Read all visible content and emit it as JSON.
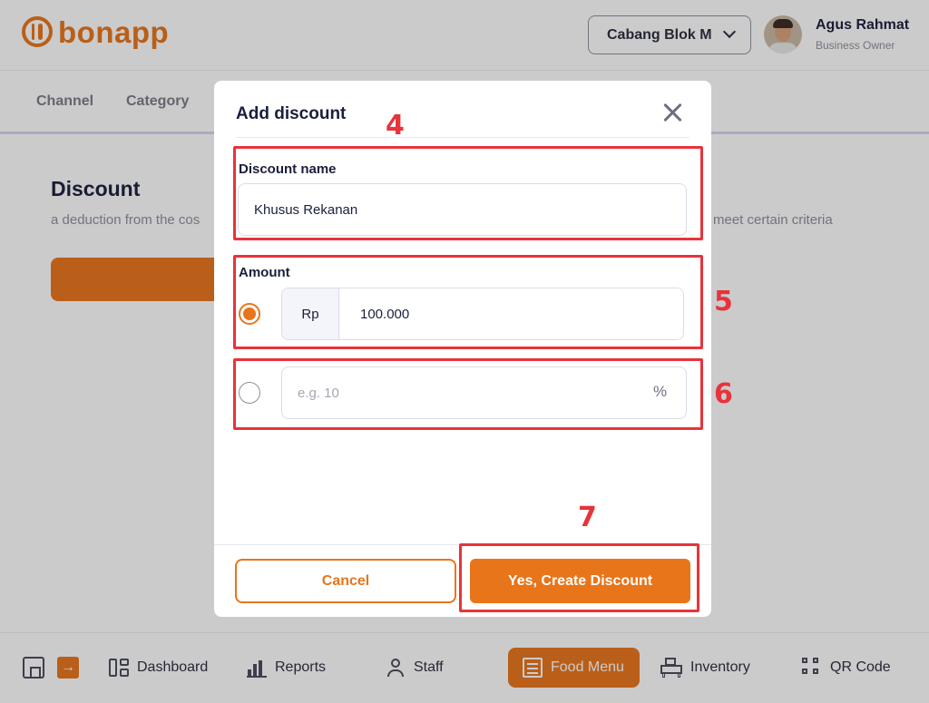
{
  "header": {
    "logo_text": "bonapp",
    "branch_selector": "Cabang Blok M",
    "user_name": "Agus Rahmat",
    "user_role": "Business Owner"
  },
  "tabs": [
    {
      "label": "Channel"
    },
    {
      "label": "Category"
    }
  ],
  "page": {
    "title": "Discount",
    "description_visible_left": "a deduction from the cos",
    "description_visible_right": "meet certain criteria"
  },
  "modal": {
    "title": "Add discount",
    "discount_name": {
      "label": "Discount name",
      "value": "Khusus Rekanan"
    },
    "amount": {
      "label": "Amount",
      "nominal_prefix": "Rp",
      "nominal_value": "100.000",
      "nominal_selected": true,
      "percent_placeholder": "e.g. 10",
      "percent_suffix": "%",
      "percent_selected": false
    },
    "cancel_label": "Cancel",
    "create_label": "Yes, Create Discount"
  },
  "annotations": [
    {
      "number": "4",
      "target": "discount-name"
    },
    {
      "number": "5",
      "target": "amount-nominal"
    },
    {
      "number": "6",
      "target": "amount-percent"
    },
    {
      "number": "7",
      "target": "create-button"
    }
  ],
  "bottom_nav": [
    {
      "label": "Dashboard",
      "icon": "dashboard-icon",
      "active": false
    },
    {
      "label": "Reports",
      "icon": "bar-chart-icon",
      "active": false
    },
    {
      "label": "Staff",
      "icon": "user-icon",
      "active": false
    },
    {
      "label": "Food Menu",
      "icon": "menu-book-icon",
      "active": true
    },
    {
      "label": "Inventory",
      "icon": "inventory-icon",
      "active": false
    },
    {
      "label": "QR Code",
      "icon": "qr-code-icon",
      "active": false
    }
  ],
  "colors": {
    "accent": "#e8751a",
    "annotation": "#e8333a",
    "text_dark": "#1b1f3b",
    "text_muted": "#8e8f99"
  }
}
